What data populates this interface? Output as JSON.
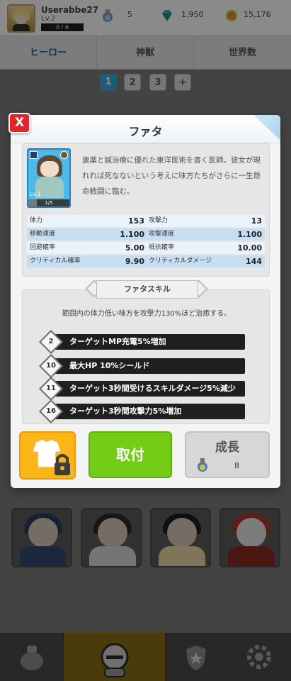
{
  "user": {
    "name": "Userabbe27",
    "level": "Lv.2",
    "xp": "0 / 6",
    "xp_fraction": 0
  },
  "resources": [
    {
      "icon": "potion-icon",
      "value": "5"
    },
    {
      "icon": "gem-icon",
      "value": "1,950"
    },
    {
      "icon": "coin-icon",
      "value": "15,176"
    }
  ],
  "tabs": [
    "ヒーロー",
    "神獣",
    "世界数"
  ],
  "pages": [
    "1",
    "2",
    "3",
    "+"
  ],
  "modal": {
    "title": "ファタ",
    "close": "X",
    "hero": {
      "level": "Lv.1",
      "fragments": "1/5",
      "fragment_fraction": 0.2
    },
    "description": "唐薬と鍼治療に優れた東洋医術を書く医師。彼女が現れれば死なないという考えに味方たちがさらに一生懸命戦闘に臨む。",
    "stats": [
      {
        "label": "体力",
        "value": "153",
        "label2": "攻撃力",
        "value2": "13"
      },
      {
        "label": "移動速度",
        "value": "1.100",
        "label2": "攻撃速度",
        "value2": "1.100"
      },
      {
        "label": "回避確率",
        "value": "5.00",
        "label2": "抵抗確率",
        "value2": "10.00"
      },
      {
        "label": "クリティカル確率",
        "value": "9.90",
        "label2": "クリティカルダメージ",
        "value2": "144"
      }
    ],
    "skill": {
      "title": "ファタスキル",
      "description": "範囲内の体力低い味方を攻撃力130%ほど治癒する。",
      "upgrades": [
        {
          "level": "2",
          "text": "ターゲットMP充電5%増加"
        },
        {
          "level": "10",
          "text": "最大HP  10%シールド"
        },
        {
          "level": "11",
          "text": "ターゲット3秒間受けるスキルダメージ5%減少"
        },
        {
          "level": "16",
          "text": "ターゲット3秒間攻撃力5%増加"
        }
      ]
    },
    "buttons": {
      "equip": "取付",
      "grow": "成長",
      "grow_cost": "8"
    }
  },
  "colors": {
    "close": "#e3242b",
    "equip": "#74cc16",
    "outfit": "#fbb516",
    "stat_row_dark": "#c7def1",
    "stat_row_light": "#eaf3fb"
  }
}
